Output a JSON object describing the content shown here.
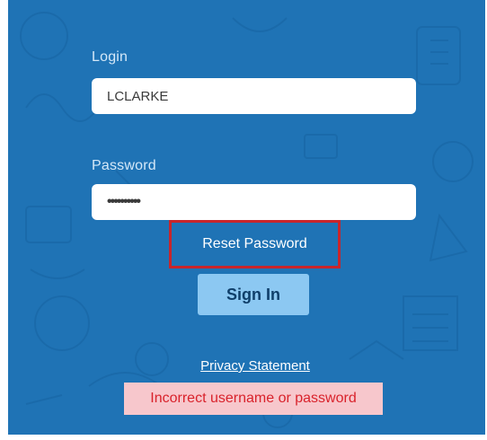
{
  "login": {
    "label": "Login",
    "value": "LCLARKE"
  },
  "password": {
    "label": "Password",
    "masked_value": "••••••••••"
  },
  "actions": {
    "reset_password": "Reset Password",
    "sign_in": "Sign In",
    "privacy_statement": "Privacy Statement"
  },
  "error": {
    "message": "Incorrect username or password"
  },
  "colors": {
    "panel_background": "#1f73b5",
    "sign_in_button": "#8cc8f2",
    "highlight_border": "#c8252b",
    "error_background": "#f7c7cc",
    "error_text": "#d9222b"
  }
}
